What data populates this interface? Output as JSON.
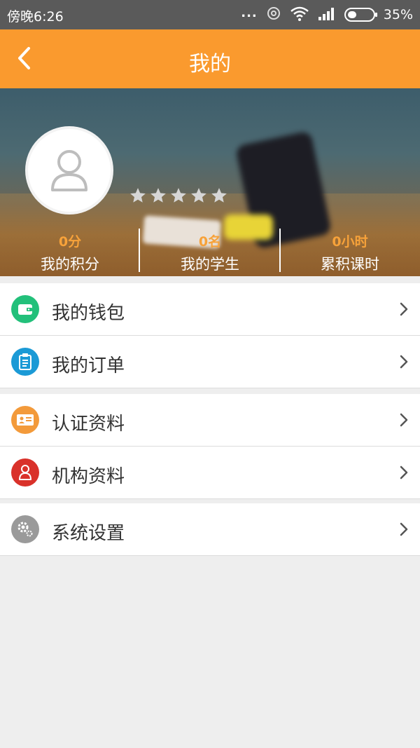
{
  "status_bar": {
    "time": "傍晚6:26",
    "dots": "...",
    "battery": "35%",
    "battery_level": 0.35
  },
  "header": {
    "title": "我的"
  },
  "profile": {
    "rating": 0,
    "stars_total": 5,
    "stats": [
      {
        "value": "0分",
        "label": "我的积分"
      },
      {
        "value": "0名",
        "label": "我的学生"
      },
      {
        "value": "0小时",
        "label": "累积课时"
      }
    ]
  },
  "menu": {
    "wallet": {
      "label": "我的钱包",
      "icon": "wallet-icon",
      "color": "#22c07a"
    },
    "orders": {
      "label": "我的订单",
      "icon": "clipboard-icon",
      "color": "#1b9ad6"
    },
    "certification": {
      "label": "认证资料",
      "icon": "id-card-icon",
      "color": "#f39a3a"
    },
    "organization": {
      "label": "机构资料",
      "icon": "user-icon",
      "color": "#d9312a"
    },
    "settings": {
      "label": "系统设置",
      "icon": "gear-icon",
      "color": "#9a9a9a"
    }
  },
  "colors": {
    "accent": "#fa9a2e",
    "stat_value": "#f7a23a"
  }
}
